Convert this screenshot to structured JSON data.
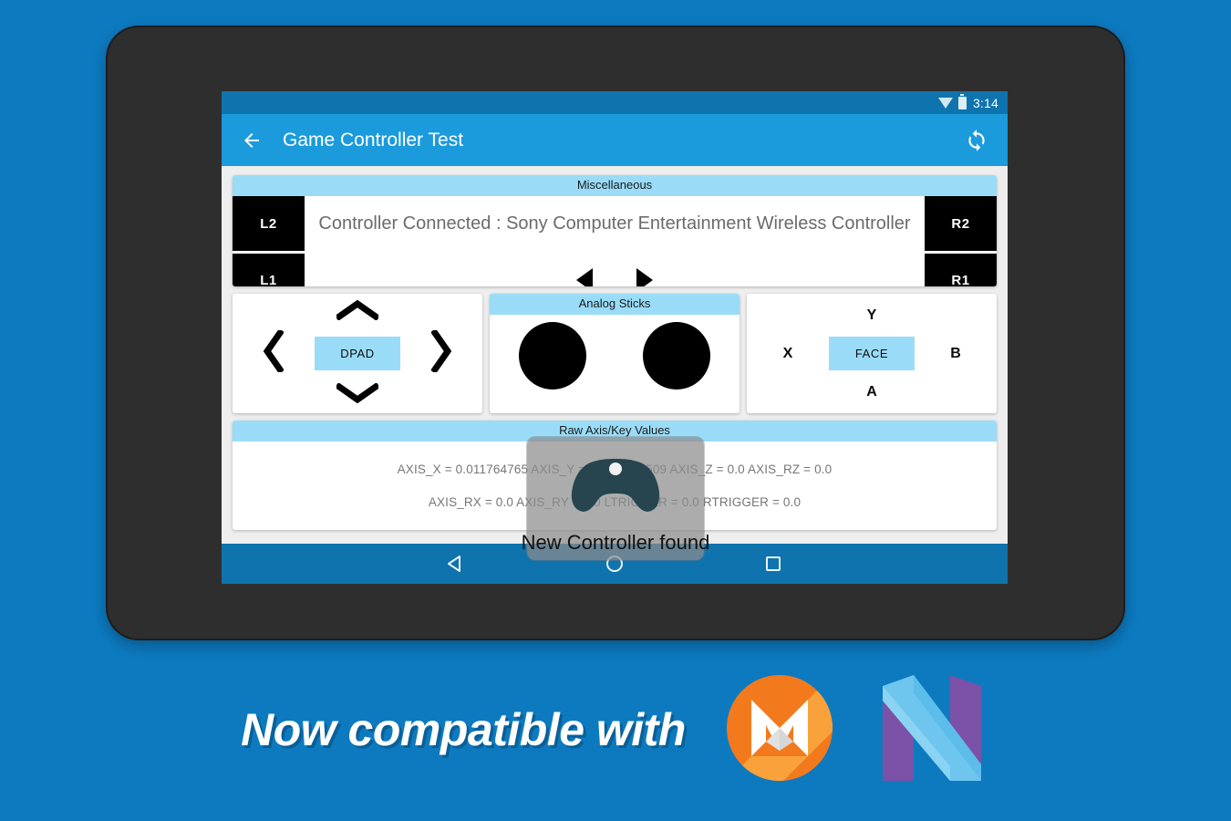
{
  "statusbar": {
    "wifi_icon": "wifi-icon",
    "battery_icon": "battery-icon",
    "clock": "3:14"
  },
  "appbar": {
    "back_icon": "back-arrow-icon",
    "title": "Game Controller Test",
    "refresh_icon": "refresh-sync-icon"
  },
  "misc": {
    "header": "Miscellaneous",
    "status_text": "Controller Connected : Sony Computer Entertainment Wireless Controller",
    "l2_label": "L2",
    "l1_label": "L1",
    "r2_label": "R2",
    "r1_label": "R1",
    "left_arrow_icon": "triangle-left-icon",
    "right_arrow_icon": "triangle-right-icon"
  },
  "dpad": {
    "center_label": "DPAD",
    "up_icon": "chevron-up-icon",
    "down_icon": "chevron-down-icon",
    "left_icon": "chevron-left-icon",
    "right_icon": "chevron-right-icon"
  },
  "analog": {
    "header": "Analog Sticks",
    "left_stick_icon": "analog-stick-left-icon",
    "right_stick_icon": "analog-stick-right-icon"
  },
  "face": {
    "center_label": "FACE",
    "top": "Y",
    "left": "X",
    "right": "B",
    "bottom": "A"
  },
  "raw": {
    "header": "Raw Axis/Key Values",
    "line1": "AXIS_X = 0.011764765  AXIS_Y = -0.003921509  AXIS_Z = 0.0  AXIS_RZ = 0.0",
    "line2": "AXIS_RX = 0.0  AXIS_RY = 0.0  LTRIGGER = 0.0  RTRIGGER = 0.0"
  },
  "toast": {
    "icon": "gamepad-icon",
    "message": "New Controller found"
  },
  "navbar": {
    "back_icon": "nav-back-icon",
    "home_icon": "nav-home-icon",
    "recents_icon": "nav-recents-icon"
  },
  "banner": {
    "text": "Now compatible with",
    "logo_marshmallow": "android-marshmallow-logo",
    "logo_nougat": "android-nougat-logo"
  },
  "colors": {
    "page_background": "#0d7ac0",
    "appbar": "#1b9bdc",
    "statusbar": "#0f73ad",
    "panel_header": "#9adcf7",
    "card_background": "#ffffff",
    "content_background": "#eeeeee",
    "shoulder_button": "#000000",
    "device_bezel": "#2e2e2e",
    "marshmallow_orange": "#f3791d",
    "nougat_purple": "#7b52a8",
    "nougat_blue": "#6ec6ef"
  }
}
